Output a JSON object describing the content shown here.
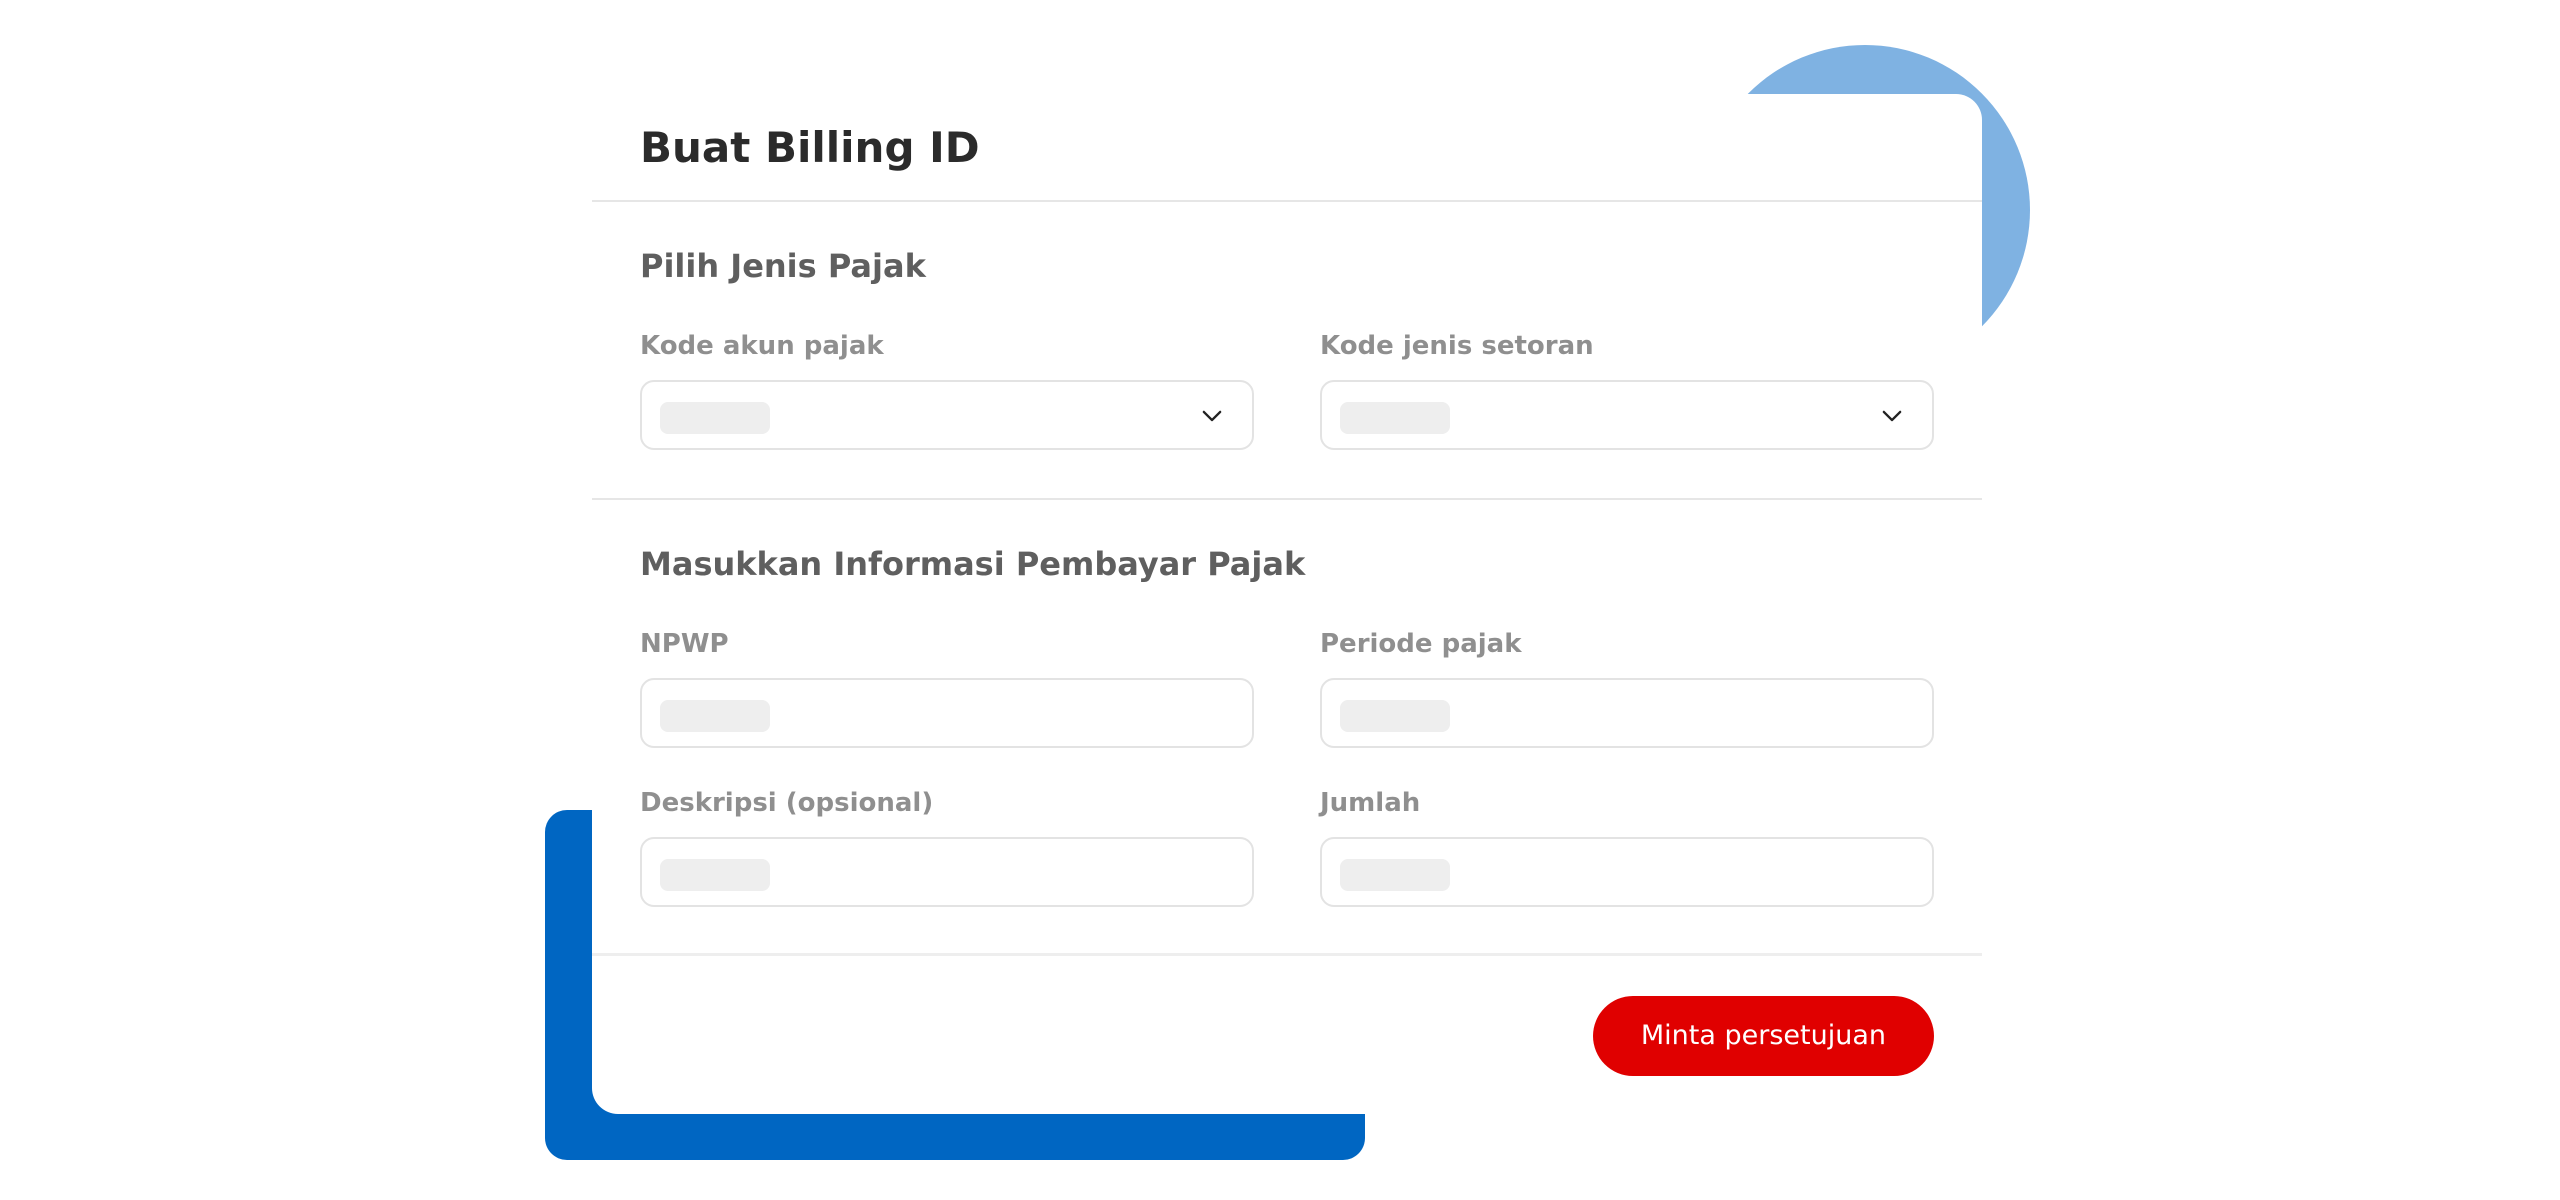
{
  "page_title": "Buat Billing ID",
  "section_tax_type": {
    "title": "Pilih Jenis Pajak",
    "fields": {
      "tax_account_code": {
        "label": "Kode akun pajak",
        "value": ""
      },
      "deposit_type_code": {
        "label": "Kode jenis setoran",
        "value": ""
      }
    }
  },
  "section_payer_info": {
    "title": "Masukkan Informasi Pembayar Pajak",
    "fields": {
      "npwp": {
        "label": "NPWP",
        "value": ""
      },
      "tax_period": {
        "label": "Periode pajak",
        "value": ""
      },
      "description": {
        "label": "Deskripsi (opsional)",
        "value": ""
      },
      "amount": {
        "label": "Jumlah",
        "value": ""
      }
    }
  },
  "footer": {
    "submit_label": "Minta persetujuan"
  },
  "icons": {
    "dropdown": "chevron-down-icon"
  },
  "colors": {
    "primary_button": "#e00000",
    "decor_blue": "#0066c2",
    "decor_light_blue": "#7fb2e2"
  }
}
